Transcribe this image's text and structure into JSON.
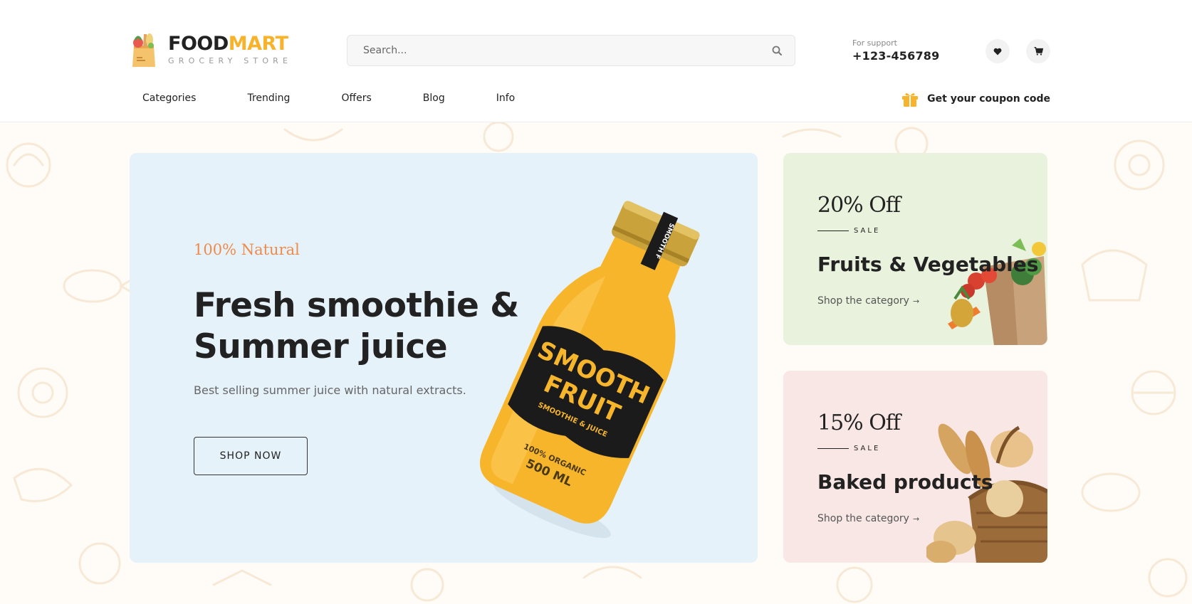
{
  "brand": {
    "name_part1": "FOOD",
    "name_part2": "MART",
    "tagline": "GROCERY STORE",
    "accent_color": "#f7b32b"
  },
  "search": {
    "placeholder": "Search...",
    "icon": "search-icon"
  },
  "support": {
    "label": "For support",
    "phone": "+123-456789"
  },
  "header_icons": [
    "heart-icon",
    "cart-icon"
  ],
  "nav": {
    "items": [
      "Categories",
      "Trending",
      "Offers",
      "Blog",
      "Info"
    ]
  },
  "coupon": {
    "icon": "gift-icon",
    "label": "Get your coupon code"
  },
  "hero": {
    "tag": "100% Natural",
    "title": "Fresh smoothie & Summer juice",
    "description": "Best selling summer juice with natural extracts.",
    "button_label": "SHOP NOW",
    "bottle_label": {
      "neck": "SMOOTH F",
      "line1": "SMOOTH",
      "line2": "FRUIT",
      "line3": "SMOOTHIE & JUICE",
      "line4": "100% ORGANIC",
      "line5": "500 ML"
    },
    "background_color": "#e6f2fa",
    "tag_color": "#ef8a4a"
  },
  "promo_cards": [
    {
      "discount": "20% Off",
      "sale_label": "SALE",
      "title": "Fruits & Vegetables",
      "link_label": "Shop the category",
      "background_color": "#e8f2dd"
    },
    {
      "discount": "15% Off",
      "sale_label": "SALE",
      "title": "Baked products",
      "link_label": "Shop the category",
      "background_color": "#f8e7e4"
    }
  ]
}
